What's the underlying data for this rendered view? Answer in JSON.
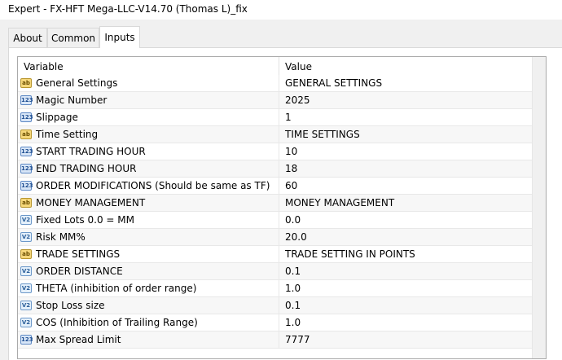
{
  "window": {
    "title": "Expert - FX-HFT Mega-LLC-V14.70 (Thomas L)_fix"
  },
  "tabs": [
    {
      "label": "About"
    },
    {
      "label": "Common"
    },
    {
      "label": "Inputs"
    }
  ],
  "active_tab": "Inputs",
  "table": {
    "headers": {
      "variable": "Variable",
      "value": "Value"
    },
    "rows": [
      {
        "icon": "ab",
        "type": "string",
        "name": "General Settings",
        "value": "GENERAL SETTINGS"
      },
      {
        "icon": "123",
        "type": "int",
        "name": "Magic Number",
        "value": "2025"
      },
      {
        "icon": "123",
        "type": "int",
        "name": "Slippage",
        "value": "1"
      },
      {
        "icon": "ab",
        "type": "string",
        "name": "Time Setting",
        "value": "TIME SETTINGS"
      },
      {
        "icon": "123",
        "type": "int",
        "name": "START TRADING HOUR",
        "value": "10"
      },
      {
        "icon": "123",
        "type": "int",
        "name": "END TRADING HOUR",
        "value": "18"
      },
      {
        "icon": "123",
        "type": "int",
        "name": "ORDER MODIFICATIONS (Should be same as TF)",
        "value": "60"
      },
      {
        "icon": "ab",
        "type": "string",
        "name": "MONEY MANAGEMENT",
        "value": "MONEY MANAGEMENT"
      },
      {
        "icon": "V2",
        "type": "double",
        "name": "Fixed Lots 0.0 = MM",
        "value": "0.0"
      },
      {
        "icon": "V2",
        "type": "double",
        "name": "Risk MM%",
        "value": "20.0"
      },
      {
        "icon": "ab",
        "type": "string",
        "name": "TRADE SETTINGS",
        "value": "TRADE SETTING IN POINTS"
      },
      {
        "icon": "V2",
        "type": "double",
        "name": "ORDER DISTANCE",
        "value": "0.1"
      },
      {
        "icon": "V2",
        "type": "double",
        "name": "THETA (inhibition of order range)",
        "value": "1.0"
      },
      {
        "icon": "V2",
        "type": "double",
        "name": "Stop Loss size",
        "value": "0.1"
      },
      {
        "icon": "V2",
        "type": "double",
        "name": "COS (Inhibition of Trailing Range)",
        "value": "1.0"
      },
      {
        "icon": "123",
        "type": "int",
        "name": "Max Spread Limit",
        "value": "7777"
      }
    ]
  }
}
